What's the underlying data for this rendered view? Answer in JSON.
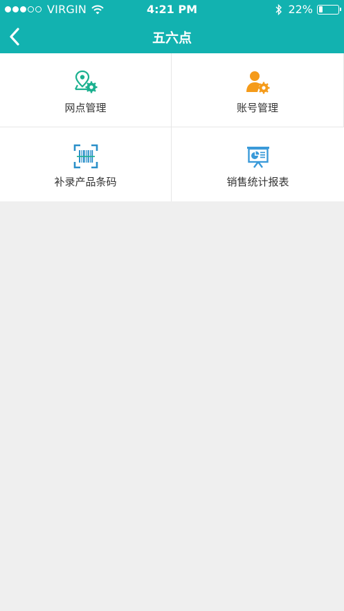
{
  "status_bar": {
    "carrier": "VIRGIN",
    "time": "4:21 PM",
    "battery_text": "22%",
    "battery_level": 0.22,
    "signal_bars": 3
  },
  "nav": {
    "title": "五六点"
  },
  "menu": [
    {
      "label": "网点管理",
      "icon": "location-settings-icon",
      "color": "#1bb08f"
    },
    {
      "label": "账号管理",
      "icon": "user-settings-icon",
      "color": "#f59b1a"
    },
    {
      "label": "补录产品条码",
      "icon": "barcode-scan-icon",
      "color": "#2a8fc9"
    },
    {
      "label": "销售统计报表",
      "icon": "presentation-chart-icon",
      "color": "#3a9ad9"
    }
  ],
  "colors": {
    "brand": "#12b2b0",
    "background": "#efefef"
  }
}
